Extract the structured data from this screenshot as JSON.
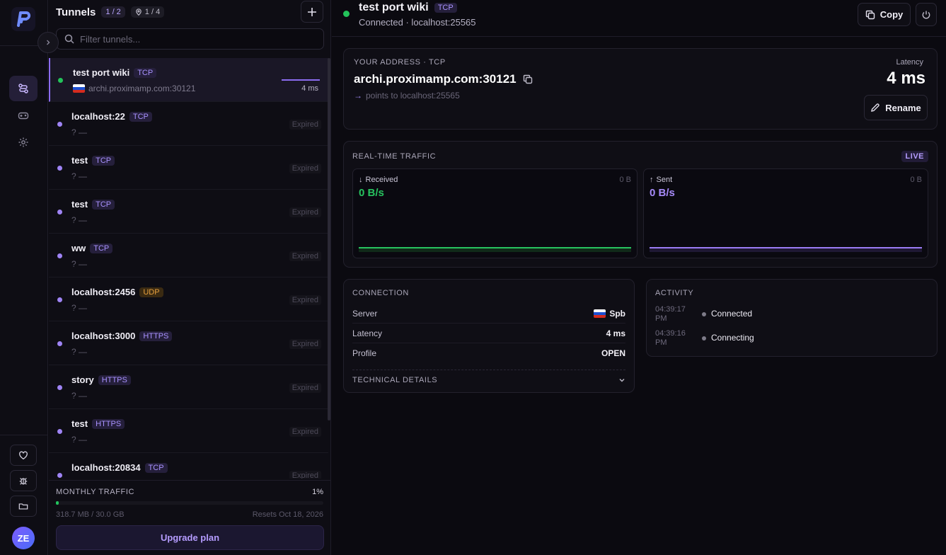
{
  "app": {
    "avatar_initials": "ZE"
  },
  "sidebar": {
    "title": "Tunnels",
    "tunnel_count": "1 / 2",
    "location_count": "1 / 4",
    "search_placeholder": "Filter tunnels...",
    "tunnels": [
      {
        "name": "test port wiki",
        "protocol": "TCP",
        "address": "archi.proximamp.com:30121",
        "status": "4 ms",
        "active": true
      },
      {
        "name": "localhost:22",
        "protocol": "TCP",
        "address": "?  —",
        "status": "Expired"
      },
      {
        "name": "test",
        "protocol": "TCP",
        "address": "?  —",
        "status": "Expired"
      },
      {
        "name": "test",
        "protocol": "TCP",
        "address": "?  —",
        "status": "Expired"
      },
      {
        "name": "ww",
        "protocol": "TCP",
        "address": "?  —",
        "status": "Expired"
      },
      {
        "name": "localhost:2456",
        "protocol": "UDP",
        "address": "?  —",
        "status": "Expired"
      },
      {
        "name": "localhost:3000",
        "protocol": "HTTPS",
        "address": "?  —",
        "status": "Expired"
      },
      {
        "name": "story",
        "protocol": "HTTPS",
        "address": "?  —",
        "status": "Expired"
      },
      {
        "name": "test",
        "protocol": "HTTPS",
        "address": "?  —",
        "status": "Expired"
      },
      {
        "name": "localhost:20834",
        "protocol": "TCP",
        "address": "?  —",
        "status": "Expired"
      }
    ],
    "traffic": {
      "label": "MONTHLY TRAFFIC",
      "percent": "1%",
      "fill_fraction": 0.01,
      "used": "318.7 MB / 30.0 GB",
      "resets": "Resets Oct 18, 2026",
      "upgrade_label": "Upgrade plan"
    }
  },
  "header": {
    "title": "test port wiki",
    "protocol": "TCP",
    "subtitle": "Connected · localhost:25565",
    "copy_label": "Copy"
  },
  "address_card": {
    "label": "YOUR ADDRESS · TCP",
    "address": "archi.proximamp.com:30121",
    "points_to": "points to localhost:25565",
    "latency_label": "Latency",
    "latency_value": "4 ms",
    "rename_label": "Rename"
  },
  "realtime": {
    "label": "REAL-TIME TRAFFIC",
    "live": "LIVE",
    "received": {
      "label": "Received",
      "total": "0 B",
      "rate": "0 B/s"
    },
    "sent": {
      "label": "Sent",
      "total": "0 B",
      "rate": "0 B/s"
    }
  },
  "connection": {
    "label": "CONNECTION",
    "rows": [
      {
        "key": "Server",
        "value": "Spb"
      },
      {
        "key": "Latency",
        "value": "4 ms"
      },
      {
        "key": "Profile",
        "value": "OPEN"
      }
    ],
    "technical_label": "TECHNICAL DETAILS"
  },
  "activity": {
    "label": "ACTIVITY",
    "events": [
      {
        "time": "04:39:17 PM",
        "text": "Connected"
      },
      {
        "time": "04:39:16 PM",
        "text": "Connecting"
      }
    ]
  },
  "colors": {
    "accent": "#8b6cf0",
    "online": "#23c35a",
    "udp": "#e7a03e"
  }
}
